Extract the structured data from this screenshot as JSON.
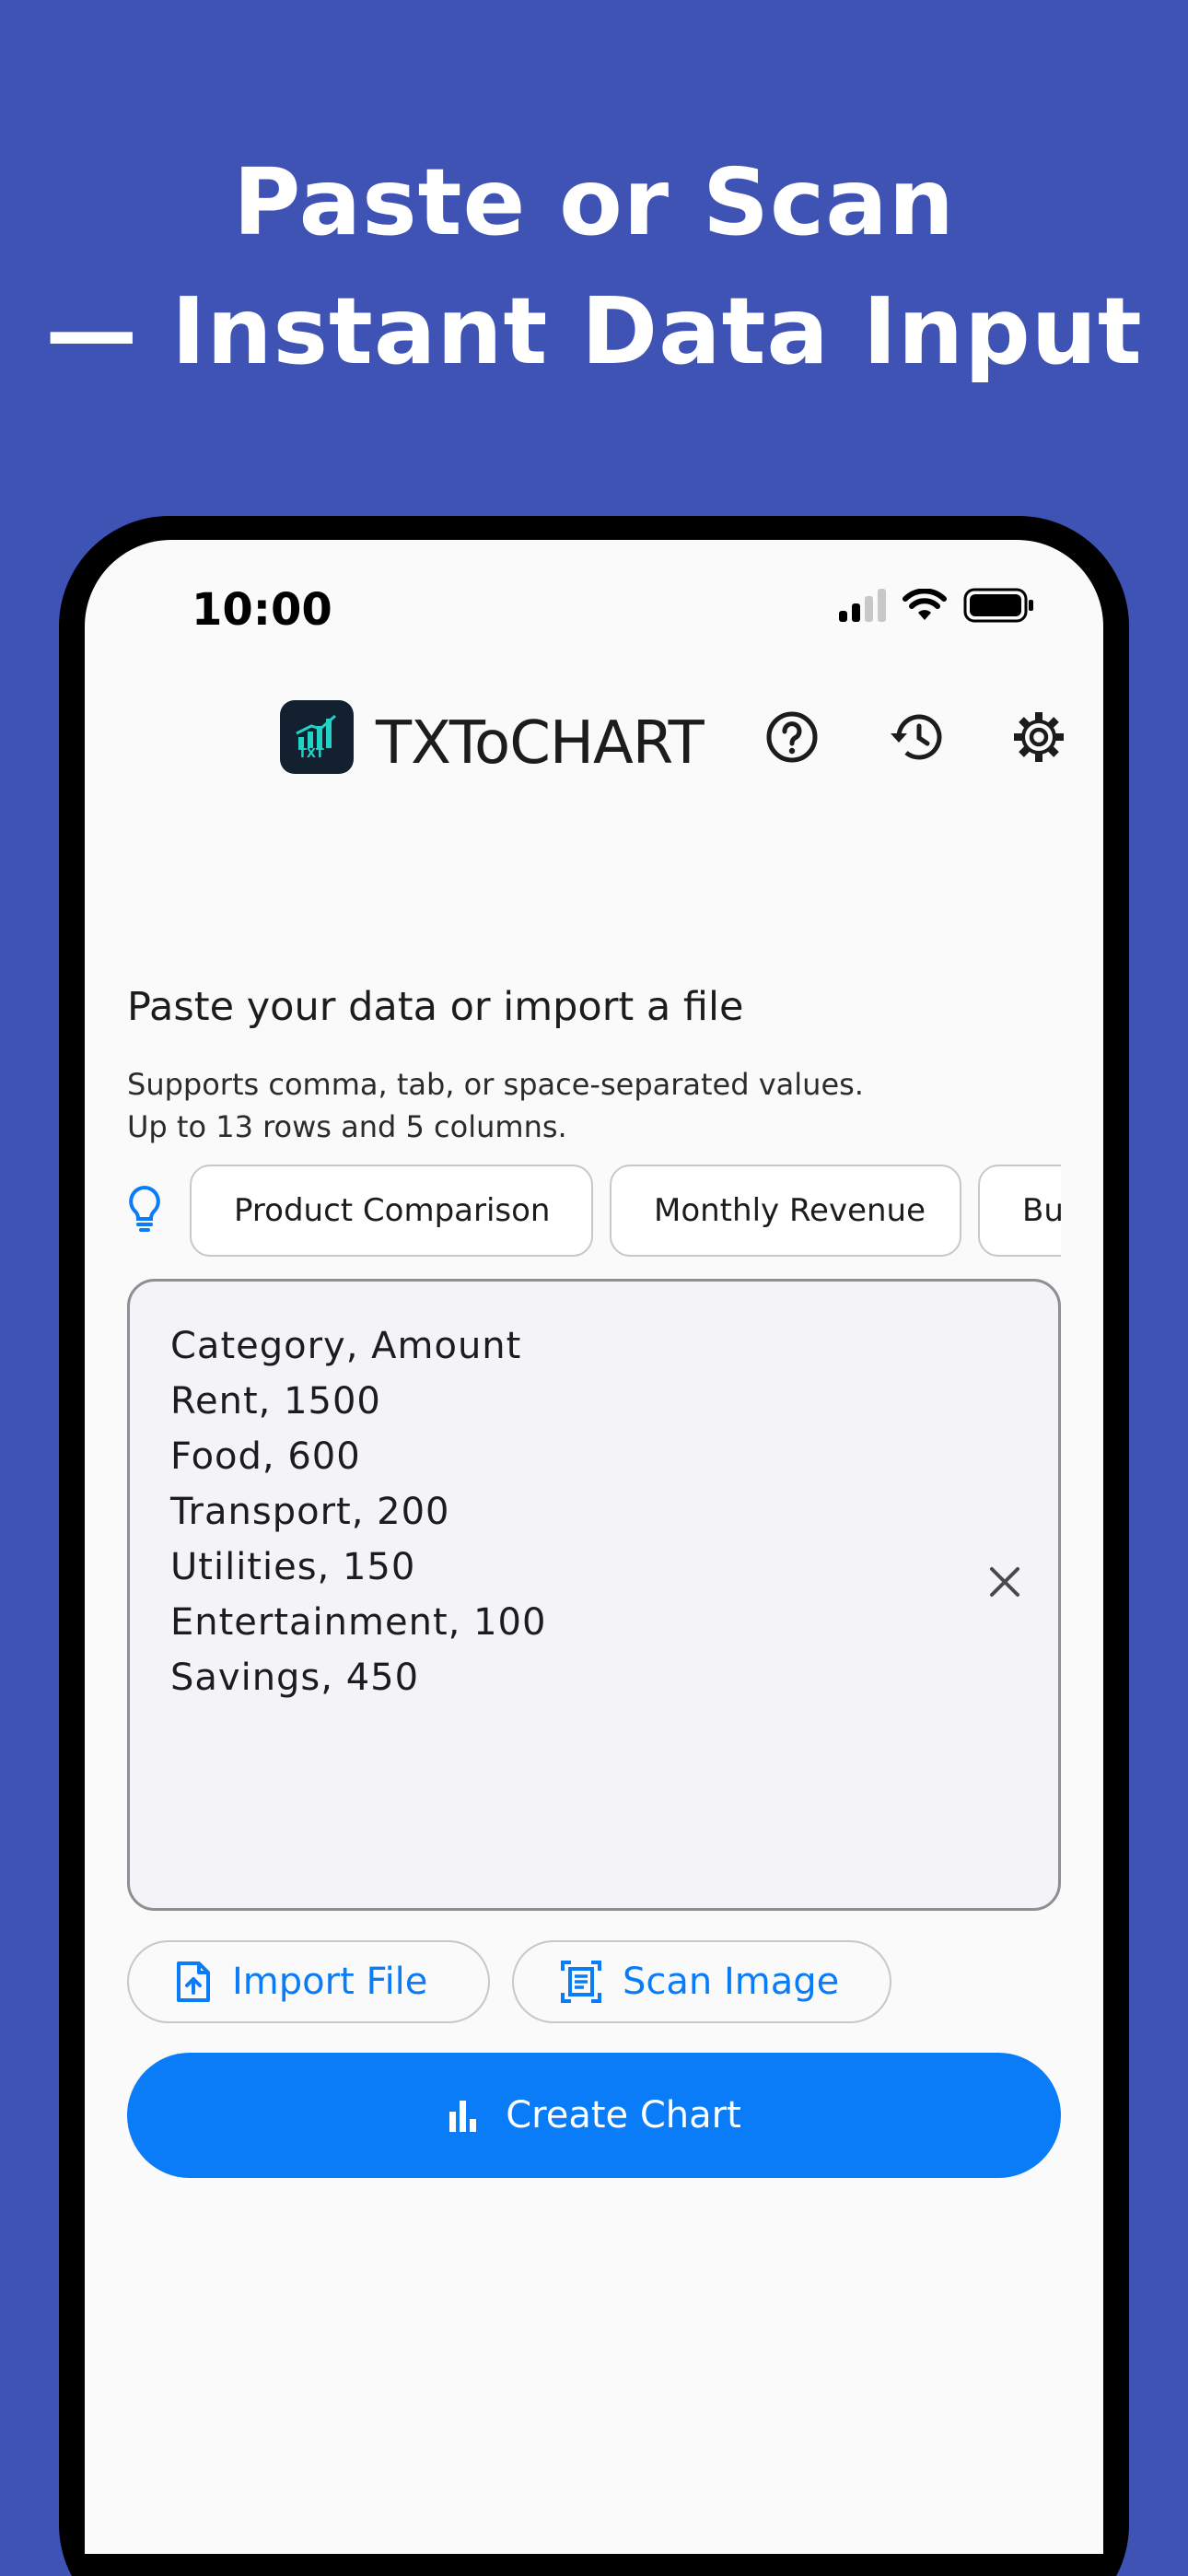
{
  "headline": {
    "line1": "Paste or Scan",
    "line2": "— Instant Data Input"
  },
  "status_bar": {
    "time": "10:00",
    "icons": [
      "cellular-signal-icon",
      "wifi-icon",
      "battery-icon"
    ]
  },
  "app_bar": {
    "logo_text": "TXT",
    "title": "TXToCHART",
    "actions": [
      "help-icon",
      "history-icon",
      "settings-icon"
    ]
  },
  "input_section": {
    "title": "Paste your data or import a file",
    "support_line1": "Supports comma, tab, or space-separated values.",
    "support_line2": "Up to 13 rows and 5 columns."
  },
  "templates": [
    "Product Comparison",
    "Monthly Revenue",
    "Bu"
  ],
  "text_input": {
    "lines": [
      "Category, Amount",
      "Rent, 1500",
      "Food, 600",
      "Transport, 200",
      "Utilities, 150",
      "Entertainment, 100",
      "Savings, 450"
    ]
  },
  "actions": {
    "import_label": "Import File",
    "scan_label": "Scan Image",
    "create_label": "Create Chart"
  },
  "colors": {
    "background": "#3f53b5",
    "accent": "#0a7cf7",
    "logo_bg": "#12202f",
    "logo_accent": "#22d3c5"
  }
}
